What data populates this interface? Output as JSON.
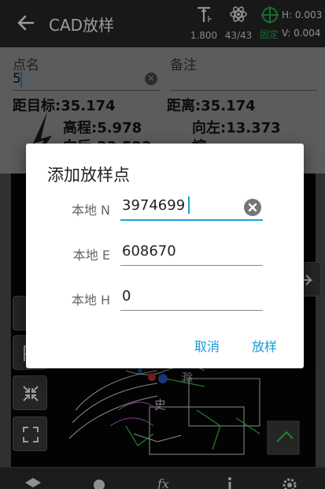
{
  "appbar": {
    "title": "CAD放样",
    "antenna_height": "1.800",
    "satellites": "43/43",
    "fix_status": "固定",
    "h_precision": "H: 0.003",
    "v_precision": "V: 0.004",
    "fix_color": "#22a84b"
  },
  "form": {
    "point_name_label": "点名",
    "point_name_value": "5",
    "remark_label": "备注",
    "dist_target": "距目标:35.174",
    "distance": "距离:35.174",
    "elevation": "高程:5.978",
    "left": "向左:13.373",
    "south_partial": "向后:33.523",
    "fill_partial": "挖:"
  },
  "dialog": {
    "title": "添加放样点",
    "fields": [
      {
        "label": "本地 N",
        "value": "3974699"
      },
      {
        "label": "本地 E",
        "value": "608670"
      },
      {
        "label": "本地 H",
        "value": "0"
      }
    ],
    "cancel_label": "取消",
    "stakeout_label": "放样",
    "accent_color": "#1a9ad6"
  },
  "map": {
    "label_1": "滁",
    "label_2": "史"
  }
}
